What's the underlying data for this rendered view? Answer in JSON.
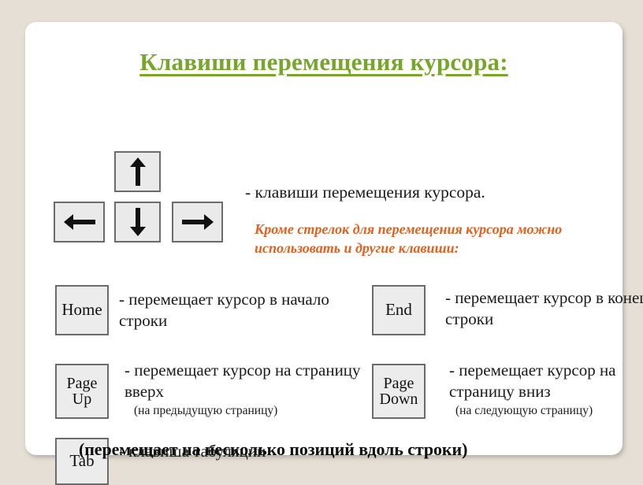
{
  "slide": {
    "title": "Клавиши перемещения курсора:",
    "title_color": "#76a62a",
    "background_color": "#e5dfd5",
    "card_color": "#ffffff"
  },
  "arrow_keys": {
    "up": "arrow-up-icon",
    "down": "arrow-down-icon",
    "left": "arrow-left-icon",
    "right": "arrow-right-icon",
    "description": "- клавиши перемещения курсора."
  },
  "note": {
    "text": "Кроме стрелок для перемещения курсора можно использовать и другие клавиши:",
    "color": "#e2611e"
  },
  "keys": [
    {
      "label": "Home",
      "description": "- перемещает курсор в начало строки",
      "sub_note": ""
    },
    {
      "label": "End",
      "description": "- перемещает курсор в конец строки",
      "sub_note": ""
    },
    {
      "label": "Page\nUp",
      "description": "- перемещает курсор на страницу вверх",
      "sub_note": "(на предыдущую страницу)"
    },
    {
      "label": "Page\nDown",
      "description": "- перемещает курсор на страницу вниз",
      "sub_note": "(на следующую страницу)"
    },
    {
      "label": "Tab",
      "description": "- клавиша табуляции",
      "sub_note": ""
    }
  ],
  "footer": {
    "text": "(перемещает на несколько позиций вдоль строки)"
  }
}
